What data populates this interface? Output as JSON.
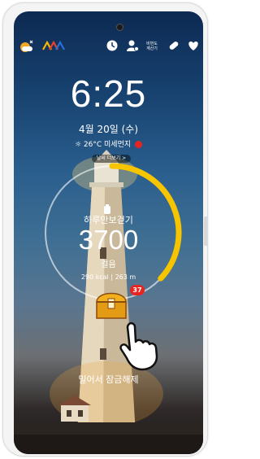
{
  "lockscreen": {
    "time": "6:25",
    "date": "4월 20일 (수)",
    "weather": "☼ 26°C  미세먼지",
    "more_button": "날씨 더보기 >"
  },
  "statusbar": {
    "walk_calc_label_line1": "비번도",
    "walk_calc_label_line2": "계산기"
  },
  "pedometer": {
    "label": "하루만보걷기",
    "steps": "3700",
    "unit": "걸음",
    "detail": "290 kcal  |  263 m",
    "goal_progress": 0.37,
    "reward_count": "37"
  },
  "swipe_hint": "밀어서 잠금해제",
  "colors": {
    "ring_progress": "#f7c500",
    "ring_track": "#ffffff",
    "badge": "#e52521"
  }
}
